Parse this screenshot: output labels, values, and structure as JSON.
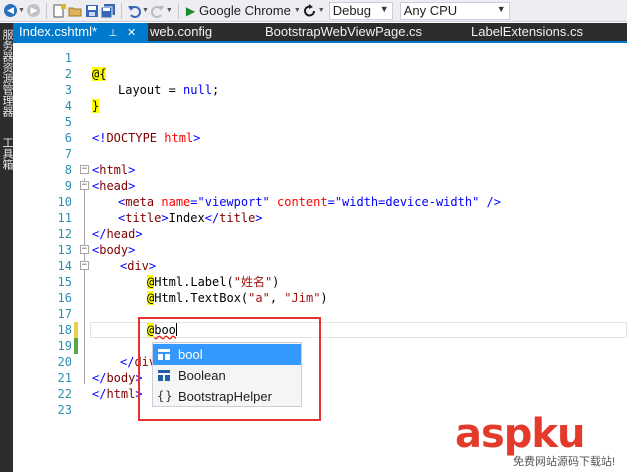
{
  "toolbar": {
    "browser": "Google Chrome",
    "config": "Debug",
    "platform": "Any CPU"
  },
  "rail": {
    "server_explorer": "服务器资源管理器",
    "toolbox": "工具箱"
  },
  "tabs": [
    {
      "label": "Index.cshtml*",
      "active": true
    },
    {
      "label": "web.config"
    },
    {
      "label": "BootstrapWebViewPage.cs"
    },
    {
      "label": "LabelExtensions.cs"
    }
  ],
  "editor": {
    "line_numbers": [
      "1",
      "2",
      "3",
      "4",
      "5",
      "6",
      "7",
      "8",
      "9",
      "10",
      "11",
      "12",
      "13",
      "14",
      "15",
      "16",
      "17",
      "18",
      "19",
      "20",
      "21",
      "22",
      "23"
    ],
    "code": {
      "l2_at": "@",
      "l2_brace": "{",
      "l3_a": "Layout = ",
      "l3_null": "null",
      "l3_semi": ";",
      "l4_brace": "}",
      "l6_open": "<!",
      "l6_doctype": "DOCTYPE",
      "l6_html": " html",
      "l6_close": ">",
      "tag_html": "html",
      "tag_head": "head",
      "tag_meta": "meta",
      "attr_name": "name",
      "val_viewport": "\"viewport\"",
      "attr_content": "content",
      "val_content": "\"width=device-width\"",
      "tag_title": "title",
      "title_text": "Index",
      "tag_body": "body",
      "tag_div": "div",
      "l15_at": "@",
      "l15_call": "Html.Label(",
      "l15_arg": "\"姓名\"",
      "l15_end": ")",
      "l16_at": "@",
      "l16_call": "Html.TextBox(",
      "l16_arg1": "\"a\"",
      "l16_comma": ", ",
      "l16_arg2": "\"Jim\"",
      "l16_end": ")",
      "l18_at": "@",
      "l18_typed": "boo"
    }
  },
  "intellisense": {
    "items": [
      {
        "label": "bool",
        "icon": "structure-icon",
        "selected": true
      },
      {
        "label": "Boolean",
        "icon": "structure-icon"
      },
      {
        "label": "BootstrapHelper",
        "icon": "namespace-icon",
        "glyph": "{}"
      }
    ]
  },
  "watermark": {
    "main": "aspku",
    "sub": "免费网站源码下载站!"
  },
  "colors": {
    "accent": "#007acc",
    "line_number": "#2b91af",
    "highlight_border": "#e53333",
    "selection": "#3399ff",
    "change_yellow": "#efce4a",
    "change_green": "#57a64a"
  }
}
